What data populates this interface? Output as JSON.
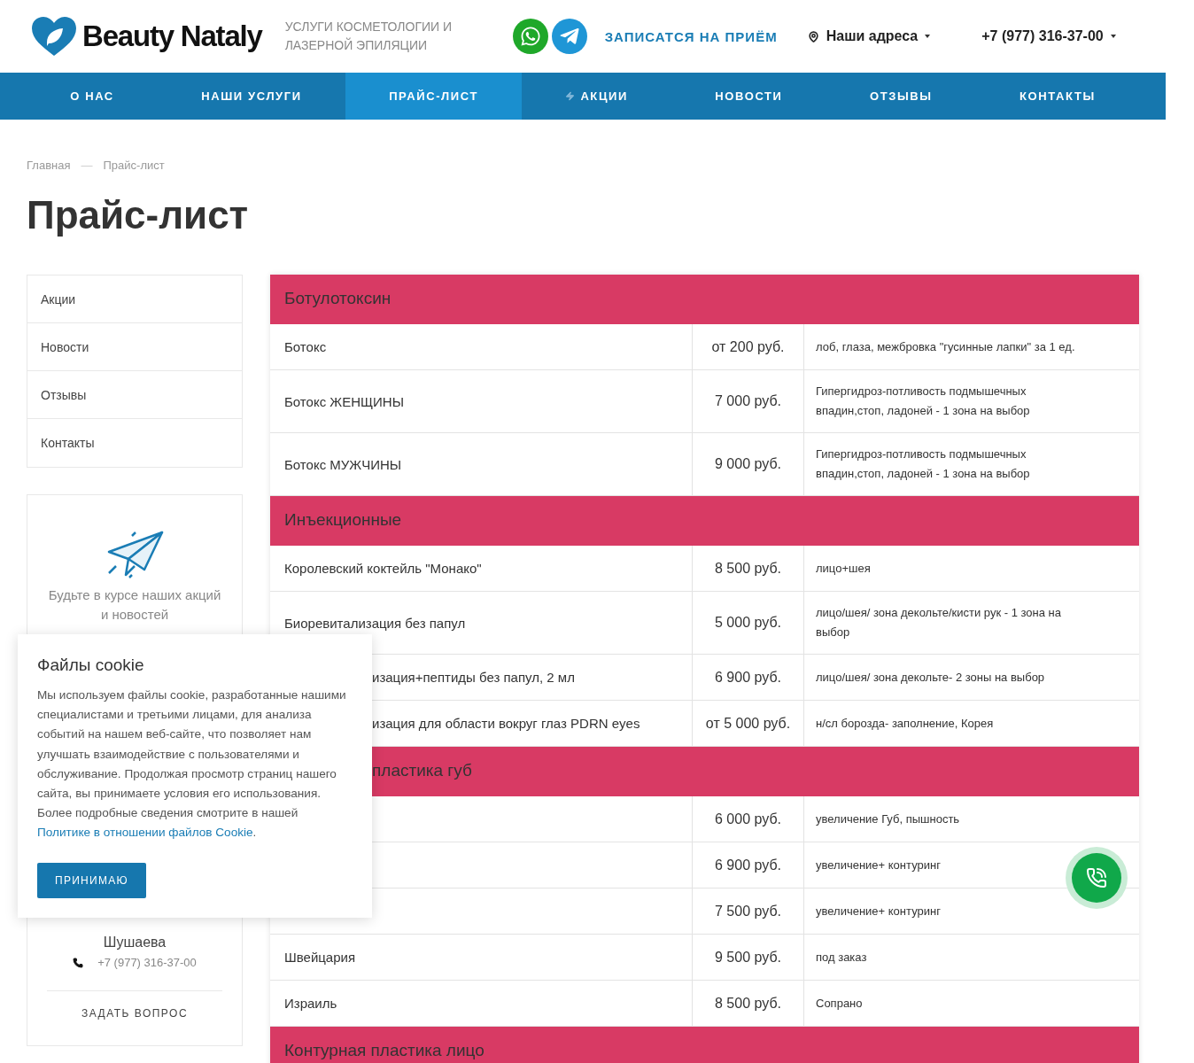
{
  "header": {
    "logo": "Beauty Nataly",
    "tagline": "УСЛУГИ КОСМЕТОЛОГИИ И ЛАЗЕРНОЙ ЭПИЛЯЦИИ",
    "booking": "ЗАПИСАТСЯ НА ПРИЁМ",
    "addresses": "Наши адреса",
    "phone": "+7 (977) 316-37-00"
  },
  "nav": [
    {
      "label": "О НАС",
      "selected": false,
      "kind": "link"
    },
    {
      "label": "НАШИ УСЛУГИ",
      "selected": false,
      "kind": "link"
    },
    {
      "label": "ПРАЙС-ЛИСТ",
      "selected": true,
      "kind": "link"
    },
    {
      "label": "АКЦИИ",
      "selected": false,
      "kind": "promo"
    },
    {
      "label": "НОВОСТИ",
      "selected": false,
      "kind": "link"
    },
    {
      "label": "ОТЗЫВЫ",
      "selected": false,
      "kind": "link"
    },
    {
      "label": "КОНТАКТЫ",
      "selected": false,
      "kind": "link"
    }
  ],
  "breadcrumbs": {
    "items": [
      "Главная",
      "Прайс-лист"
    ],
    "separator": "—"
  },
  "title": "Прайс-лист",
  "sidebar": {
    "menu": [
      "Акции",
      "Новости",
      "Отзывы",
      "Контакты"
    ],
    "subscribe": "Будьте в курсе наших акций и новостей",
    "contact_name": "Шушаева",
    "contact_phone": "+7 (977) 316-37-00",
    "ask": "ЗАДАТЬ ВОПРОС"
  },
  "price_groups": [
    {
      "title": "Ботулотоксин",
      "cut": false,
      "rows": [
        {
          "name": "Ботокс",
          "price": "от 200 руб.",
          "note": "лоб, глаза, межбровка \"гусинные лапки\" за 1 ед.",
          "cut": false
        },
        {
          "name": "Ботокс ЖЕНЩИНЫ",
          "price": "7 000 руб.",
          "note": "Гипергидроз-потливость подмышечных впадин,стоп, ладоней - 1 зона на выбор",
          "cut": false
        },
        {
          "name": "Ботокс МУЖЧИНЫ",
          "price": "9 000 руб.",
          "note": "Гипергидроз-потливость подмышечных впадин,стоп, ладоней - 1 зона на выбор",
          "cut": false
        }
      ]
    },
    {
      "title": "Инъекционные",
      "cut": false,
      "rows": [
        {
          "name": "Королевский коктейль \"Монако\"",
          "price": "8 500 руб.",
          "note": "лицо+шея",
          "cut": false
        },
        {
          "name": "Биоревитализация без папул",
          "price": "5 000 руб.",
          "note": "лицо/шея/ зона декольте/кисти рук - 1 зона на выбор",
          "cut": false
        },
        {
          "name": "изация+пептиды без папул, 2 мл",
          "price": "6 900 руб.",
          "note": "лицо/шея/ зона декольте- 2 зоны на выбор",
          "cut": true
        },
        {
          "name": "изация для области вокруг глаз PDRN eyes",
          "price": "от 5 000 руб.",
          "note": "н/сл борозда- заполнение, Корея",
          "cut": true
        }
      ]
    },
    {
      "title": "пластика губ",
      "cut": true,
      "rows": [
        {
          "price": "6 000 руб.",
          "note": "увеличение Губ, пышность"
        },
        {
          "price": "6 900 руб.",
          "note": "увеличение+ контуринг"
        },
        {
          "price": "7 500 руб.",
          "note": "увеличение+ контуринг"
        },
        {
          "name": "Швейцария",
          "price": "9 500 руб.",
          "note": "под заказ",
          "cut": false
        },
        {
          "name": "Израиль",
          "price": "8 500 руб.",
          "note": "Сопрано",
          "cut": false
        }
      ]
    },
    {
      "title": "Контурная пластика лицо",
      "cut": false
    }
  ],
  "cookie": {
    "title": "Файлы cookie",
    "text": "Мы используем файлы cookie, разработанные нашими специалистами и третьими лицами, для анализа событий на нашем веб-сайте, что позволяет нам улучшать взаимодействие с пользователями и обслуживание. Продолжая просмотр страниц нашего сайта, вы принимаете условия его использования. Более подробные сведения смотрите в нашей",
    "link": "Политике в отношении файлов Cookie",
    "end": ".",
    "button": "ПРИНИМАЮ"
  }
}
